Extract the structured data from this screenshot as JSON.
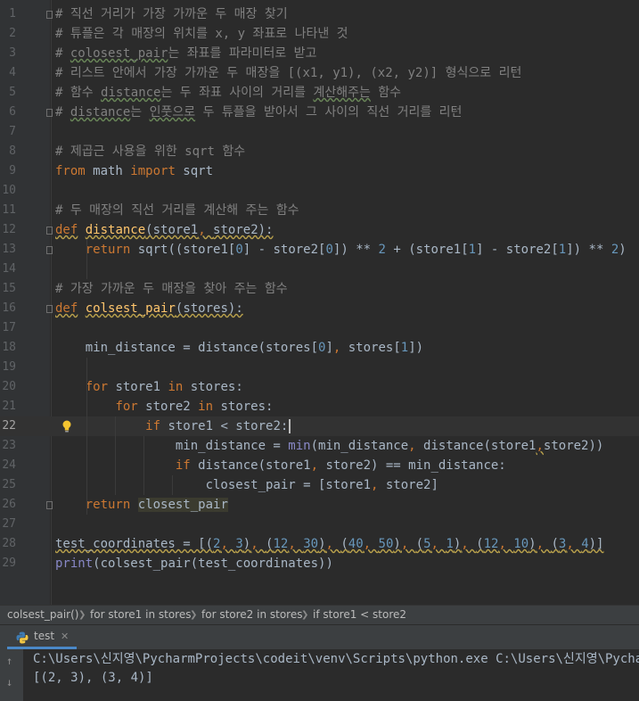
{
  "editor": {
    "colors": {
      "comment": "#808080",
      "keyword": "#cc7832",
      "number": "#6897bb",
      "function": "#ffc66d",
      "builtin": "#8888c6",
      "text": "#a9b7c6"
    },
    "current_line": 22,
    "lines": [
      {
        "n": "1",
        "tokens": [
          {
            "t": "# 직선 거리가 가장 가까운 두 매장 찾기",
            "c": "com"
          }
        ]
      },
      {
        "n": "2",
        "tokens": [
          {
            "t": "# 튜플은 각 매장의 위치를 x, y 좌표로 나타낸 것",
            "c": "com"
          }
        ]
      },
      {
        "n": "3",
        "tokens": [
          {
            "t": "# ",
            "c": "com"
          },
          {
            "t": "colosest_pair",
            "c": "com",
            "w": "g"
          },
          {
            "t": "는 좌표를 파라미터로 받고",
            "c": "com"
          }
        ]
      },
      {
        "n": "4",
        "tokens": [
          {
            "t": "# 리스트 안에서 가장 가까운 두 매장을 [(x1, y1), (x2, y2)] 형식으로 리턴",
            "c": "com"
          }
        ]
      },
      {
        "n": "5",
        "tokens": [
          {
            "t": "# 함수 ",
            "c": "com"
          },
          {
            "t": "distance",
            "c": "com",
            "w": "g"
          },
          {
            "t": "는 두 좌표 사이의 거리를 ",
            "c": "com"
          },
          {
            "t": "계산해주는",
            "c": "com",
            "w": "g"
          },
          {
            "t": " 함수",
            "c": "com"
          }
        ]
      },
      {
        "n": "6",
        "tokens": [
          {
            "t": "# ",
            "c": "com"
          },
          {
            "t": "distance",
            "c": "com",
            "w": "g"
          },
          {
            "t": "는 ",
            "c": "com"
          },
          {
            "t": "인풋으로",
            "c": "com",
            "w": "g"
          },
          {
            "t": " 두 튜플을 받아서 그 사이의 직선 거리를 리턴",
            "c": "com"
          }
        ]
      },
      {
        "n": "7",
        "tokens": []
      },
      {
        "n": "8",
        "tokens": [
          {
            "t": "# 제곱근 사용을 위한 sqrt 함수",
            "c": "com"
          }
        ]
      },
      {
        "n": "9",
        "tokens": [
          {
            "t": "from",
            "c": "kw"
          },
          {
            "t": " math "
          },
          {
            "t": "import",
            "c": "kw"
          },
          {
            "t": " sqrt"
          }
        ]
      },
      {
        "n": "10",
        "tokens": []
      },
      {
        "n": "11",
        "tokens": [
          {
            "t": "# 두 매장의 직선 거리를 계산해 주는 함수",
            "c": "com"
          }
        ]
      },
      {
        "n": "12",
        "tokens": [
          {
            "t": "def",
            "c": "kw",
            "w": "y"
          },
          {
            "t": " "
          },
          {
            "t": "distance",
            "c": "fn",
            "w": "y"
          },
          {
            "t": "(store1",
            "w": "y"
          },
          {
            "t": ", ",
            "c": "kw",
            "w": "y"
          },
          {
            "t": "store2):",
            "w": "y"
          }
        ]
      },
      {
        "n": "13",
        "tokens": [
          {
            "t": "    "
          },
          {
            "t": "return",
            "c": "kw"
          },
          {
            "t": " sqrt((store1["
          },
          {
            "t": "0",
            "c": "num"
          },
          {
            "t": "] - store2["
          },
          {
            "t": "0",
            "c": "num"
          },
          {
            "t": "]) ** "
          },
          {
            "t": "2",
            "c": "num"
          },
          {
            "t": " + (store1["
          },
          {
            "t": "1",
            "c": "num"
          },
          {
            "t": "] - store2["
          },
          {
            "t": "1",
            "c": "num"
          },
          {
            "t": "]) ** "
          },
          {
            "t": "2",
            "c": "num"
          },
          {
            "t": ")"
          }
        ]
      },
      {
        "n": "14",
        "tokens": []
      },
      {
        "n": "15",
        "tokens": [
          {
            "t": "# 가장 가까운 두 매장을 찾아 주는 함수",
            "c": "com"
          }
        ]
      },
      {
        "n": "16",
        "tokens": [
          {
            "t": "def",
            "c": "kw",
            "w": "y"
          },
          {
            "t": " "
          },
          {
            "t": "colsest_pair",
            "c": "fn",
            "w": "y"
          },
          {
            "t": "(stores):",
            "w": "y"
          }
        ]
      },
      {
        "n": "17",
        "tokens": []
      },
      {
        "n": "18",
        "tokens": [
          {
            "t": "    min_distance = distance(stores["
          },
          {
            "t": "0",
            "c": "num"
          },
          {
            "t": "]"
          },
          {
            "t": ", ",
            "c": "kw"
          },
          {
            "t": "stores["
          },
          {
            "t": "1",
            "c": "num"
          },
          {
            "t": "])"
          }
        ]
      },
      {
        "n": "19",
        "tokens": []
      },
      {
        "n": "20",
        "tokens": [
          {
            "t": "    "
          },
          {
            "t": "for",
            "c": "kw"
          },
          {
            "t": " store1 "
          },
          {
            "t": "in",
            "c": "kw"
          },
          {
            "t": " stores:"
          }
        ]
      },
      {
        "n": "21",
        "tokens": [
          {
            "t": "        "
          },
          {
            "t": "for",
            "c": "kw"
          },
          {
            "t": " store2 "
          },
          {
            "t": "in",
            "c": "kw"
          },
          {
            "t": " stores:"
          }
        ]
      },
      {
        "n": "22",
        "tokens": [
          {
            "t": "            "
          },
          {
            "t": "if",
            "c": "kw"
          },
          {
            "t": " store1 < store2:"
          }
        ]
      },
      {
        "n": "23",
        "tokens": [
          {
            "t": "                min_distance = "
          },
          {
            "t": "min",
            "c": "bi"
          },
          {
            "t": "(min_distance"
          },
          {
            "t": ", ",
            "c": "kw"
          },
          {
            "t": "distance(store1"
          },
          {
            "t": ",",
            "c": "kw",
            "w": "y"
          },
          {
            "t": "store2))"
          }
        ]
      },
      {
        "n": "24",
        "tokens": [
          {
            "t": "                "
          },
          {
            "t": "if",
            "c": "kw"
          },
          {
            "t": " distance(store1"
          },
          {
            "t": ", ",
            "c": "kw"
          },
          {
            "t": "store2) == min_distance:"
          }
        ]
      },
      {
        "n": "25",
        "tokens": [
          {
            "t": "                    closest_pair = [store1"
          },
          {
            "t": ", ",
            "c": "kw"
          },
          {
            "t": "store2]"
          }
        ]
      },
      {
        "n": "26",
        "tokens": [
          {
            "t": "    "
          },
          {
            "t": "return",
            "c": "kw"
          },
          {
            "t": " "
          },
          {
            "t": "closest_pair",
            "h": true
          }
        ]
      },
      {
        "n": "27",
        "tokens": []
      },
      {
        "n": "28",
        "tokens": [
          {
            "t": "test_coordinates = [(",
            "w": "y"
          },
          {
            "t": "2",
            "c": "num",
            "w": "y"
          },
          {
            "t": ", ",
            "c": "kw",
            "w": "y"
          },
          {
            "t": "3",
            "c": "num",
            "w": "y"
          },
          {
            "t": ")",
            "w": "y"
          },
          {
            "t": ", ",
            "c": "kw",
            "w": "y"
          },
          {
            "t": "(",
            "w": "y"
          },
          {
            "t": "12",
            "c": "num",
            "w": "y"
          },
          {
            "t": ", ",
            "c": "kw",
            "w": "y"
          },
          {
            "t": "30",
            "c": "num",
            "w": "y"
          },
          {
            "t": ")",
            "w": "y"
          },
          {
            "t": ", ",
            "c": "kw",
            "w": "y"
          },
          {
            "t": "(",
            "w": "y"
          },
          {
            "t": "40",
            "c": "num",
            "w": "y"
          },
          {
            "t": ", ",
            "c": "kw",
            "w": "y"
          },
          {
            "t": "50",
            "c": "num",
            "w": "y"
          },
          {
            "t": ")",
            "w": "y"
          },
          {
            "t": ", ",
            "c": "kw",
            "w": "y"
          },
          {
            "t": "(",
            "w": "y"
          },
          {
            "t": "5",
            "c": "num",
            "w": "y"
          },
          {
            "t": ", ",
            "c": "kw",
            "w": "y"
          },
          {
            "t": "1",
            "c": "num",
            "w": "y"
          },
          {
            "t": ")",
            "w": "y"
          },
          {
            "t": ", ",
            "c": "kw",
            "w": "y"
          },
          {
            "t": "(",
            "w": "y"
          },
          {
            "t": "12",
            "c": "num",
            "w": "y"
          },
          {
            "t": ", ",
            "c": "kw",
            "w": "y"
          },
          {
            "t": "10",
            "c": "num",
            "w": "y"
          },
          {
            "t": ")",
            "w": "y"
          },
          {
            "t": ", ",
            "c": "kw",
            "w": "y"
          },
          {
            "t": "(",
            "w": "y"
          },
          {
            "t": "3",
            "c": "num",
            "w": "y"
          },
          {
            "t": ", ",
            "c": "kw",
            "w": "y"
          },
          {
            "t": "4",
            "c": "num",
            "w": "y"
          },
          {
            "t": ")]",
            "w": "y"
          }
        ]
      },
      {
        "n": "29",
        "tokens": [
          {
            "t": "print",
            "c": "bi"
          },
          {
            "t": "(colsest_pair(test_coordinates))"
          }
        ]
      }
    ]
  },
  "breadcrumb": [
    "colsest_pair()",
    "for store1 in stores",
    "for store2 in stores",
    "if store1 < store2"
  ],
  "run": {
    "tab_label": "test",
    "close_glyph": "✕",
    "output_lines": [
      "C:\\Users\\신지영\\PycharmProjects\\codeit\\venv\\Scripts\\python.exe C:\\Users\\신지영\\PycharmProjects\\codeit\\test.py",
      "[(2, 3), (3, 4)]"
    ]
  },
  "icons": {
    "fold": "fold-marker-icon",
    "bulb": "lightbulb-icon",
    "python": "python-icon",
    "up": "arrow-up-icon",
    "down": "arrow-down-icon"
  }
}
